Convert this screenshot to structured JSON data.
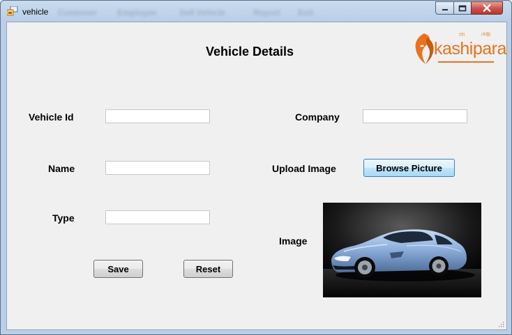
{
  "window": {
    "title": "vehicle",
    "menu_items": [
      "Customer",
      "Employee",
      "Sell Vehicle",
      "Report",
      "Exit"
    ]
  },
  "form": {
    "heading": "Vehicle Details",
    "labels": {
      "vehicle_id": "Vehicle Id",
      "name": "Name",
      "type": "Type",
      "company": "Company",
      "upload_image": "Upload Image",
      "image": "Image"
    },
    "fields": {
      "vehicle_id": "",
      "name": "",
      "type": "",
      "company": ""
    },
    "buttons": {
      "save": "Save",
      "reset": "Reset",
      "browse": "Browse Picture"
    }
  },
  "logo": {
    "text": "kashipara",
    "colors": {
      "brand": "#e8731d"
    }
  },
  "icons": [
    "app-icon",
    "minimize-icon",
    "maximize-icon",
    "close-icon",
    "size-grip-icon"
  ]
}
